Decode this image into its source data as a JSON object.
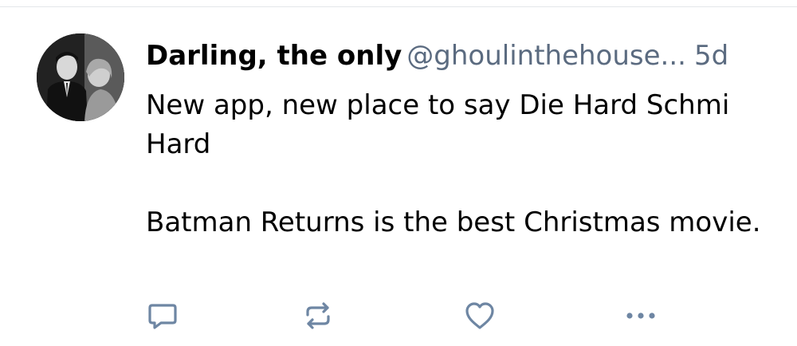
{
  "post": {
    "author": {
      "display_name": "Darling, the only",
      "handle": "@ghoulinthehouse..."
    },
    "timestamp": "5d",
    "text": {
      "line1": "New app, new place to say Die Hard Schmi Hard",
      "line2": "Batman Returns is the best Christmas movie."
    },
    "actions": {
      "reply_icon": "reply-icon",
      "repost_icon": "repost-icon",
      "like_icon": "heart-icon",
      "more_icon": "more-options-icon"
    }
  },
  "colors": {
    "text_primary": "#000000",
    "text_secondary": "#5b6b80",
    "icon": "#6e86a3",
    "divider": "#e3e6ea"
  }
}
